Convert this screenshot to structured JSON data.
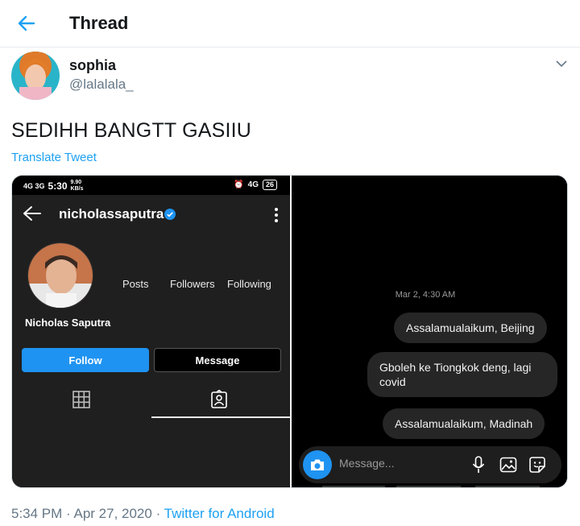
{
  "header": {
    "title": "Thread",
    "back_icon": "arrow-left-icon"
  },
  "author": {
    "name": "sophia",
    "handle": "@lalalala_"
  },
  "tweet": {
    "text": "SEDIHH BANGTT GASIIU",
    "translate_label": "Translate Tweet"
  },
  "media": {
    "profile_screen": {
      "status_time": "5:30",
      "status_left": "4G 3G",
      "status_speed": "9.90 KB/s",
      "status_right": "4G",
      "battery": "26",
      "username": "nicholassaputra",
      "full_name": "Nicholas Saputra",
      "stats": {
        "posts": "Posts",
        "followers": "Followers",
        "following": "Following"
      },
      "follow_label": "Follow",
      "message_label": "Message"
    },
    "dm_screen": {
      "timestamp": "Mar 2, 4:30 AM",
      "messages": [
        "Assalamualaikum, Beijing",
        "Gboleh ke Tiongkok deng, lagi covid",
        "Assalamualaikum, Madinah"
      ],
      "composer_placeholder": "Message..."
    }
  },
  "meta": {
    "time": "5:34 PM",
    "date": "Apr 27, 2020",
    "separator": " · ",
    "source": "Twitter for Android"
  },
  "colors": {
    "accent": "#1da1f2",
    "ig_blue": "#1f93f1",
    "muted": "#657786"
  }
}
